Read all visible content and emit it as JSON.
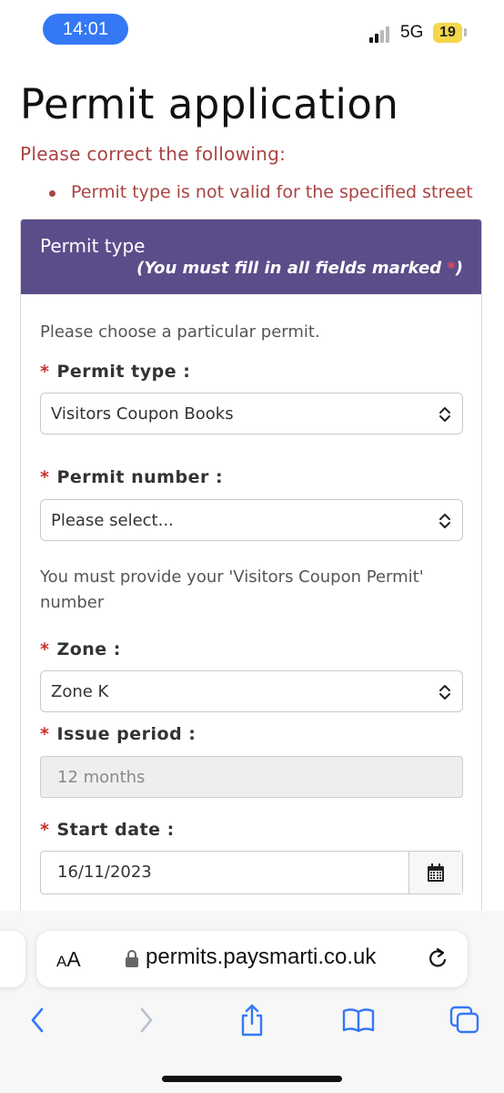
{
  "status_bar": {
    "time": "14:01",
    "network": "5G",
    "battery": "19"
  },
  "page": {
    "title": "Permit application",
    "error_heading": "Please correct the following:",
    "errors": [
      "Permit type is not valid for the specified street"
    ]
  },
  "panel": {
    "title": "Permit type",
    "required_note": "(You must fill in all fields marked ",
    "required_star": "*",
    "required_note_end": ")",
    "intro": "Please choose a particular permit."
  },
  "form": {
    "permit_type": {
      "label": "Permit type :",
      "value": "Visitors Coupon Books"
    },
    "permit_number": {
      "label": "Permit number :",
      "value": "Please select...",
      "help": "You must provide your 'Visitors Coupon Permit' number"
    },
    "zone": {
      "label": "Zone :",
      "value": "Zone K"
    },
    "issue_period": {
      "label": "Issue period :",
      "value": "12 months"
    },
    "start_date": {
      "label": "Start date :",
      "value": "16/11/2023"
    }
  },
  "browser": {
    "text_size_small": "A",
    "text_size_big": "A",
    "url": "permits.paysmarti.co.uk"
  },
  "colors": {
    "accent": "#5b4d8a",
    "error": "#a94442",
    "required": "#c9302c",
    "ios_blue": "#3478f6"
  }
}
